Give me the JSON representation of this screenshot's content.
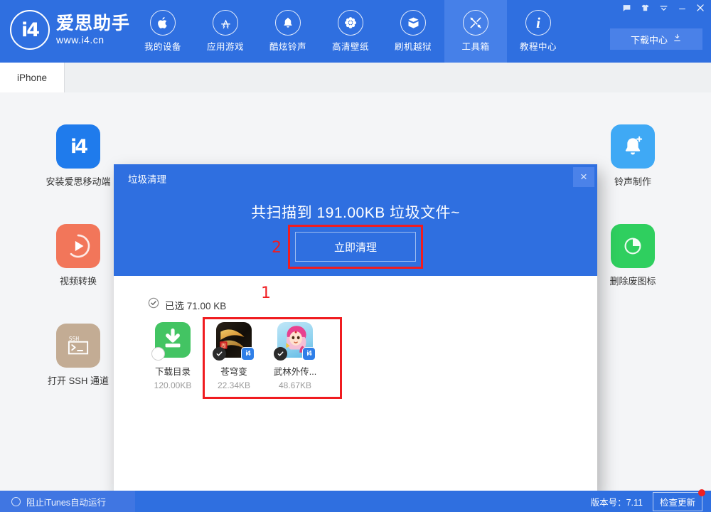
{
  "brand": {
    "logo_mark": "i4",
    "title": "爱思助手",
    "url": "www.i4.cn"
  },
  "nav": {
    "items": [
      {
        "label": "我的设备",
        "icon": "apple-icon",
        "active": false
      },
      {
        "label": "应用游戏",
        "icon": "appstore-icon",
        "active": false
      },
      {
        "label": "酷炫铃声",
        "icon": "bell-icon",
        "active": false
      },
      {
        "label": "高清壁纸",
        "icon": "flower-icon",
        "active": false
      },
      {
        "label": "刷机越狱",
        "icon": "box-icon",
        "active": false
      },
      {
        "label": "工具箱",
        "icon": "tools-icon",
        "active": true
      },
      {
        "label": "教程中心",
        "icon": "info-icon",
        "active": false
      }
    ],
    "download_center": "下载中心"
  },
  "window_controls": [
    {
      "name": "feedback-icon",
      "glyph": "message"
    },
    {
      "name": "skin-icon",
      "glyph": "shirt"
    },
    {
      "name": "menu-icon",
      "glyph": "chevron-bar"
    },
    {
      "name": "minimize-icon",
      "glyph": "minimize"
    },
    {
      "name": "close-icon",
      "glyph": "close"
    }
  ],
  "tabs": {
    "device_tab": "iPhone"
  },
  "tools_left": [
    {
      "label": "安装爱思移动端",
      "icon": "i4-app-icon",
      "color": "#1f7bec"
    },
    {
      "label": "视频转换",
      "icon": "video-convert-icon",
      "color": "#f2765a"
    },
    {
      "label": "打开 SSH 通道",
      "icon": "ssh-terminal-icon",
      "color": "#c3ac94"
    }
  ],
  "tools_right": [
    {
      "label": "铃声制作",
      "icon": "ringtone-maker-icon",
      "color": "#3fa9f5"
    },
    {
      "label": "删除废图标",
      "icon": "remove-icon-icon",
      "color": "#2fcf5f"
    }
  ],
  "dialog": {
    "title": "垃圾清理",
    "close_label": "×",
    "scan_message": "共扫描到 191.00KB 垃圾文件~",
    "clean_button": "立即清理",
    "selected_label": "已选 71.00 KB",
    "files": [
      {
        "name": "下载目录",
        "size": "120.00KB",
        "checked": false,
        "icon": "download-folder-icon",
        "badge": false
      },
      {
        "name": "苍穹变",
        "size": "22.34KB",
        "checked": true,
        "icon": "game-cangqiongbian-icon",
        "badge": true
      },
      {
        "name": "武林外传...",
        "size": "48.67KB",
        "checked": true,
        "icon": "game-wulinwaizhuan-icon",
        "badge": true
      }
    ]
  },
  "annotations": [
    {
      "number": "1",
      "target": "file-selection-box"
    },
    {
      "number": "2",
      "target": "clean-button-box"
    }
  ],
  "statusbar": {
    "itunes_toggle_label": "阻止iTunes自动运行",
    "version_label": "版本号：7.11",
    "update_button": "检查更新"
  },
  "colors": {
    "brand_blue": "#2f6fe0",
    "nav_active": "#4680e8",
    "annotation_red": "#f01c20",
    "badge_red": "#f02020"
  }
}
